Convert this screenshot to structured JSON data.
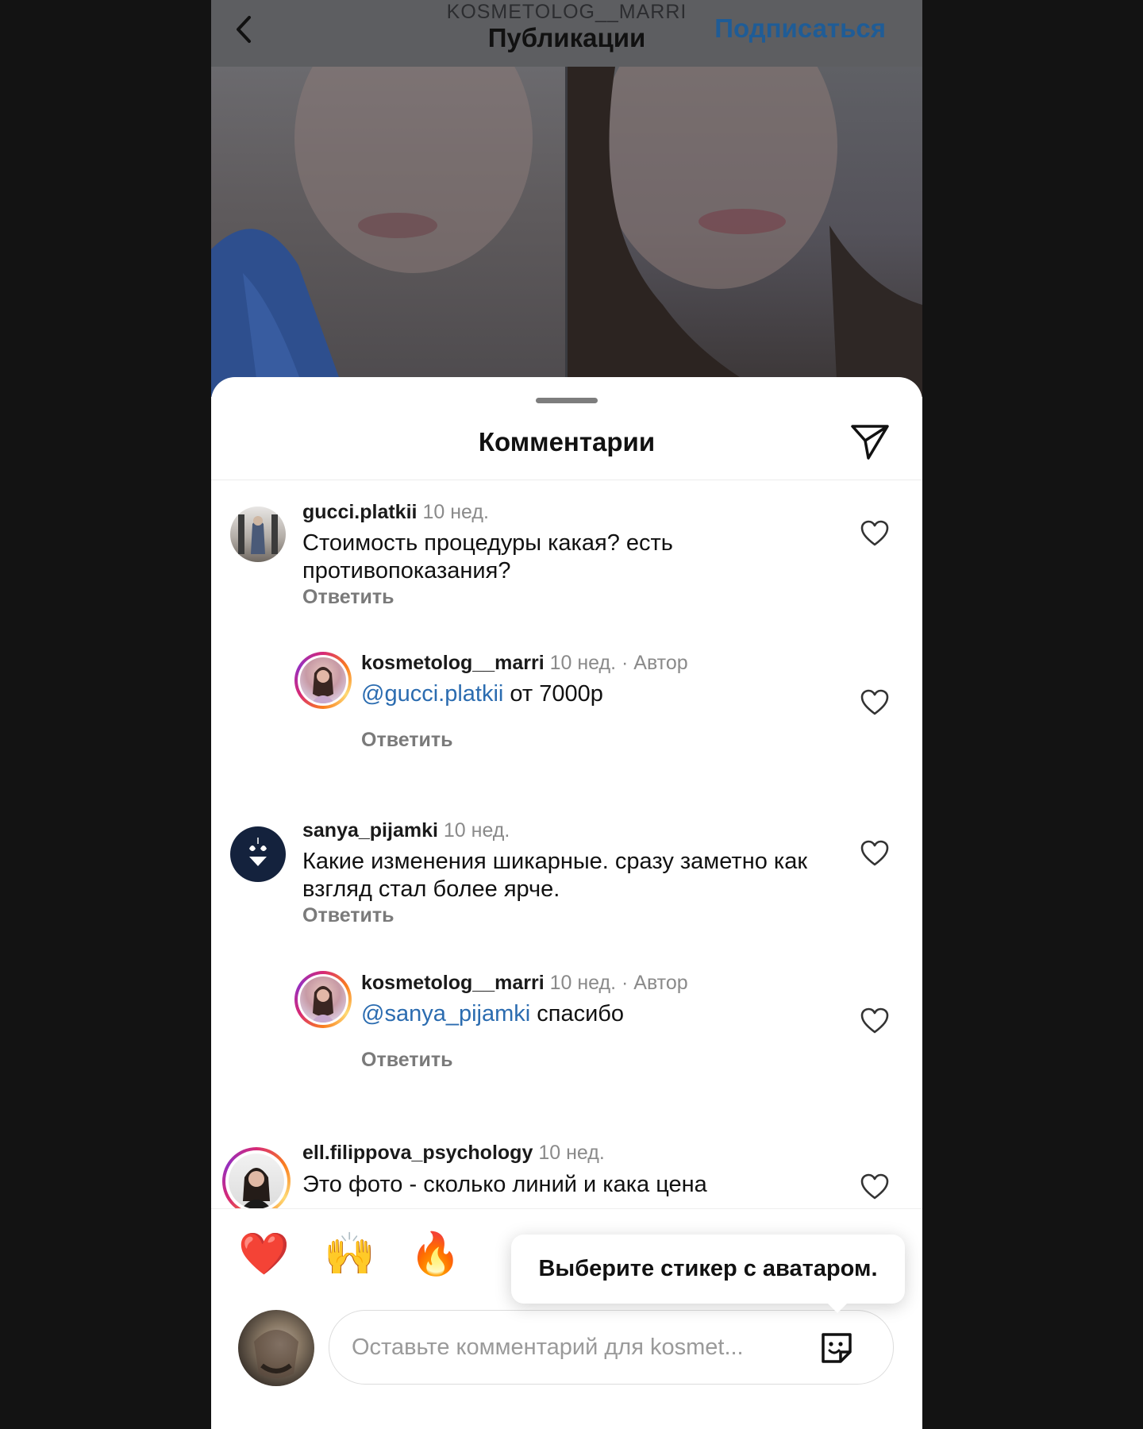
{
  "header": {
    "username": "KOSMETOLOG__MARRI",
    "title": "Публикации",
    "follow_label": "Подписаться"
  },
  "sheet": {
    "title": "Комментарии"
  },
  "comments": [
    {
      "username": "gucci.platkii",
      "time": "10 нед.",
      "text": "Стоимость процедуры какая? есть противопоказания?",
      "reply_label": "Ответить"
    },
    {
      "username": "kosmetolog__marri",
      "time": "10 нед.",
      "author_badge": "· Автор",
      "mention": "@gucci.platkii",
      "text": " от 7000р",
      "reply_label": "Ответить"
    },
    {
      "username": "sanya_pijamki",
      "time": "10 нед.",
      "text": "Какие изменения шикарные. сразу заметно как взгляд стал более ярче.",
      "reply_label": "Ответить"
    },
    {
      "username": "kosmetolog__marri",
      "time": "10 нед.",
      "author_badge": "· Автор",
      "mention": "@sanya_pijamki",
      "text": " спасибо",
      "reply_label": "Ответить"
    },
    {
      "username": "ell.filippova_psychology",
      "time": "10 нед.",
      "text": "Это фото - сколько линий и кака цена"
    }
  ],
  "quick_reactions": [
    "❤️",
    "🙌",
    "🔥"
  ],
  "tooltip": "Выберите стикер с аватаром.",
  "composer": {
    "placeholder": "Оставьте комментарий для kosmet..."
  },
  "colors": {
    "link": "#2b6cb0",
    "follow": "#1f5c96",
    "muted": "#8a8a8a"
  }
}
